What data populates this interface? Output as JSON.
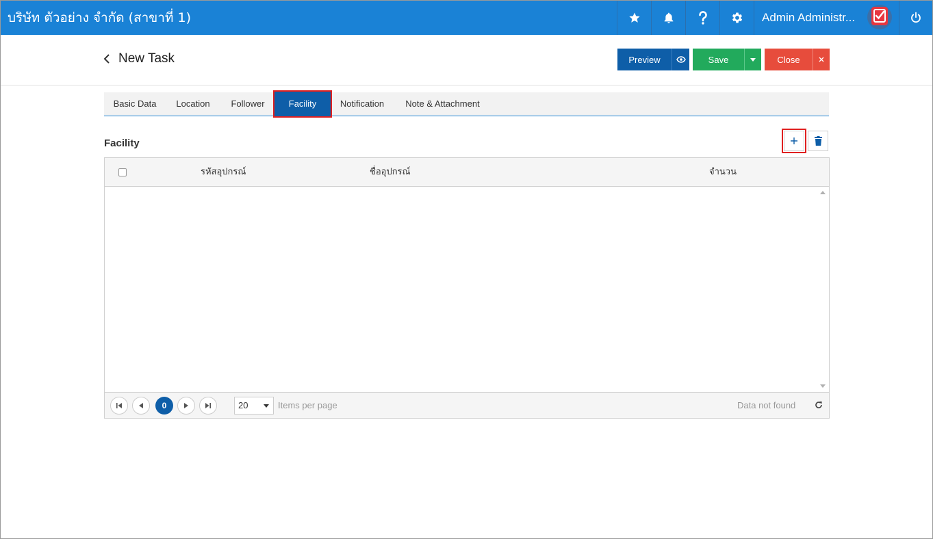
{
  "topbar": {
    "company": "บริษัท ตัวอย่าง จำกัด (สาขาที่ 1)",
    "user_name": "Admin Administr...",
    "bg_color": "#1a82d6",
    "icons": [
      "star-icon",
      "bell-icon",
      "help-icon",
      "gear-icon",
      "power-icon"
    ]
  },
  "header": {
    "title": "New Task",
    "preview_label": "Preview",
    "save_label": "Save",
    "close_label": "Close"
  },
  "tabs": [
    {
      "label": "Basic Data",
      "active": false
    },
    {
      "label": "Location",
      "active": false
    },
    {
      "label": "Follower",
      "active": false
    },
    {
      "label": "Facility",
      "active": true
    },
    {
      "label": "Notification",
      "active": false
    },
    {
      "label": "Note & Attachment",
      "active": false
    }
  ],
  "facility": {
    "title": "Facility",
    "columns": [
      "รหัสอุปกรณ์",
      "ชื่ออุปกรณ์",
      "จำนวน"
    ],
    "rows": []
  },
  "pager": {
    "current_page": "0",
    "page_size": "20",
    "items_per_page_label": "Items per page",
    "status": "Data not found"
  },
  "colors": {
    "primary": "#0e5ea8",
    "save": "#22aa5c",
    "close": "#e74c3c",
    "highlight": "#e02020"
  }
}
